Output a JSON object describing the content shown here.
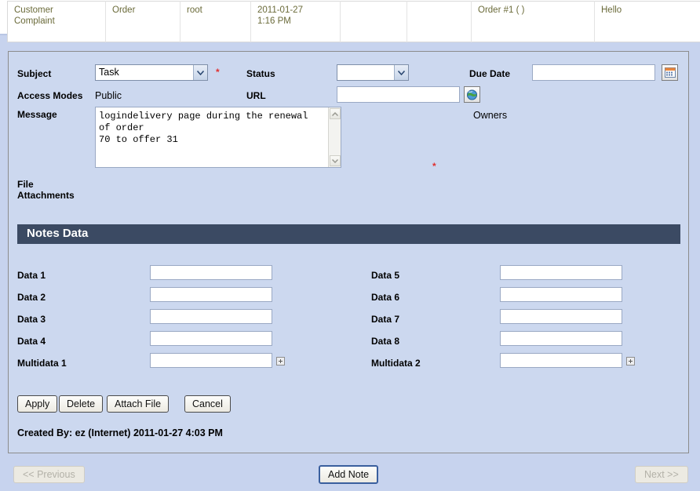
{
  "summary_table": {
    "columns": [
      "type",
      "category",
      "user",
      "datetime",
      "blank1",
      "blank2",
      "order",
      "greeting",
      "print"
    ],
    "row": {
      "type": "Customer\nComplaint",
      "category": "Order",
      "user": "root",
      "datetime": "2011-01-27\n1:16 PM",
      "blank1": "",
      "blank2": "",
      "order": "Order #1 ( )",
      "greeting": "Hello",
      "print_icon": "printer-icon"
    }
  },
  "form": {
    "subject": {
      "label": "Subject",
      "value": "Task",
      "required_marker": "*",
      "icon": "chevron-down-icon"
    },
    "status": {
      "label": "Status",
      "value": "",
      "icon": "chevron-down-icon"
    },
    "due_date": {
      "label": "Due Date",
      "value": "",
      "placeholder": "",
      "icon": "calendar-icon"
    },
    "access_modes": {
      "label": "Access Modes",
      "value": "Public"
    },
    "url": {
      "label": "URL",
      "value": "",
      "placeholder": "",
      "icon": "globe-icon"
    },
    "owners": {
      "label": "Owners",
      "value": ""
    },
    "message": {
      "label": "Message",
      "value": "logindelivery page during the renewal of order\n70 to offer 31",
      "required_marker": "*",
      "scroll_up_icon": "chevron-up-icon",
      "scroll_down_icon": "chevron-down-icon"
    },
    "file_attachments": {
      "label": "File\nAttachments"
    }
  },
  "notes_data": {
    "header": "Notes Data",
    "left_fields": [
      {
        "label": "Data 1",
        "value": "",
        "addon": null
      },
      {
        "label": "Data 2",
        "value": "",
        "addon": null
      },
      {
        "label": "Data 3",
        "value": "",
        "addon": null
      },
      {
        "label": "Data 4",
        "value": "",
        "addon": null
      },
      {
        "label": "Multidata 1",
        "value": "",
        "addon": "plus-icon"
      }
    ],
    "right_fields": [
      {
        "label": "Data 5",
        "value": "",
        "addon": null
      },
      {
        "label": "Data 6",
        "value": "",
        "addon": null
      },
      {
        "label": "Data 7",
        "value": "",
        "addon": null
      },
      {
        "label": "Data 8",
        "value": "",
        "addon": null
      },
      {
        "label": "Multidata 2",
        "value": "",
        "addon": "plus-icon"
      }
    ]
  },
  "actions": {
    "apply": "Apply",
    "delete": "Delete",
    "attach_file": "Attach File",
    "cancel": "Cancel"
  },
  "created_by": "Created By: ez (Internet) 2011-01-27 4:03 PM",
  "pager": {
    "previous": "<< Previous",
    "add_note": "Add Note",
    "next": "Next >>"
  },
  "colors": {
    "page_background": "#c7d3ee",
    "panel_background": "#ccd8ef",
    "section_header": "#3b4a63",
    "summary_text": "#6b6b3a",
    "required": "#e03030"
  }
}
